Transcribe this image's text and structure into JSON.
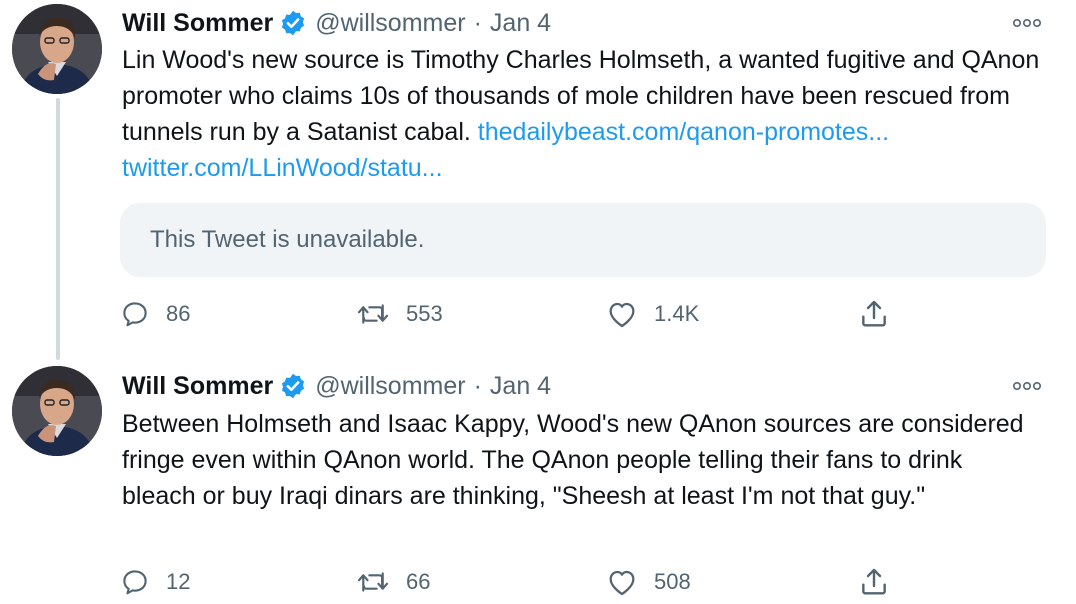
{
  "tweets": [
    {
      "author": {
        "display_name": "Will Sommer",
        "handle": "@willsommer",
        "verified_icon": "verified-badge-icon",
        "avatar": "user-photo"
      },
      "separator": "·",
      "date": "Jan 4",
      "body": {
        "text": "Lin Wood's new source is Timothy Charles Holmseth, a  wanted fugitive and QAnon promoter who claims 10s of thousands of mole children have been rescued from  tunnels run by a Satanist cabal. ",
        "link_1": "thedailybeast.com/qanon-promotes...",
        "link_2": "twitter.com/LLinWood/statu..."
      },
      "quoted_tweet": "This Tweet is unavailable.",
      "actions": {
        "replies": "86",
        "retweets": "553",
        "likes": "1.4K"
      }
    },
    {
      "author": {
        "display_name": "Will Sommer",
        "handle": "@willsommer",
        "verified_icon": "verified-badge-icon",
        "avatar": "user-photo"
      },
      "separator": "·",
      "date": "Jan 4",
      "body": {
        "text": "Between Holmseth and Isaac Kappy, Wood's new QAnon sources are considered fringe even within QAnon world. The QAnon people telling their fans to drink bleach or buy Iraqi dinars are thinking, \"Sheesh at least I'm not that guy.\""
      },
      "actions": {
        "replies": "12",
        "retweets": "66",
        "likes": "508"
      }
    }
  ],
  "colors": {
    "text": "#0f1419",
    "secondary_text": "#536471",
    "link": "#1d9bf0",
    "verified": "#1d9bf0",
    "card_background": "#f1f4f7",
    "thread_line": "#cfd9de"
  }
}
